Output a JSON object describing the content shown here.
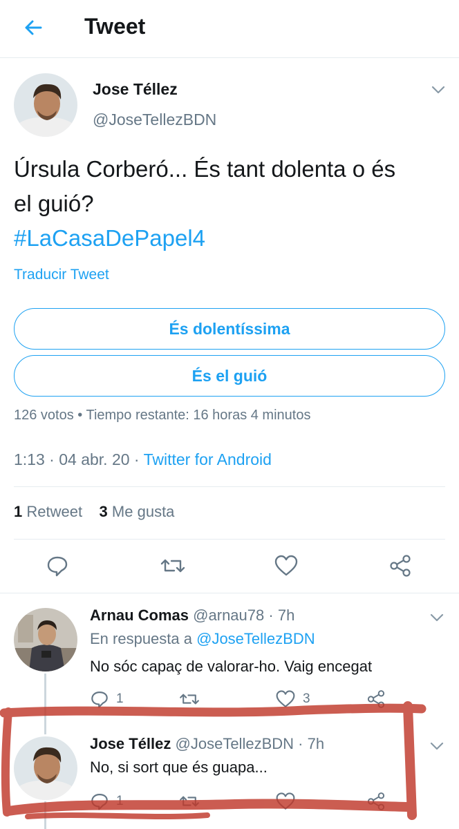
{
  "header": {
    "title": "Tweet"
  },
  "tweet": {
    "author_name": "Jose Téllez",
    "author_handle": "@JoseTellezBDN",
    "text_line1": "Úrsula Corberó... És tant dolenta o és",
    "text_line2": "el guió?",
    "hashtag": "#LaCasaDePapel4",
    "translate_label": "Traducir Tweet",
    "poll": {
      "options": [
        "És dolentíssima",
        "És el guió"
      ],
      "meta": "126 votos • Tiempo restante: 16 horas 4 minutos"
    },
    "time": "1:13",
    "date": "04 abr. 20",
    "source": "Twitter for Android",
    "retweets_count": "1",
    "retweets_label": "Retweet",
    "likes_count": "3",
    "likes_label": "Me gusta"
  },
  "replies": [
    {
      "name": "Arnau Comas",
      "handle": "@arnau78",
      "time": "7h",
      "reply_prefix": "En respuesta a",
      "reply_mention": "@JoseTellezBDN",
      "text": "No sóc capaç de valorar-ho. Vaig encegat",
      "reply_count": "1",
      "like_count": "3"
    },
    {
      "name": "Jose Téllez",
      "handle": "@JoseTellezBDN",
      "time": "7h",
      "text": "No, si sort que és guapa...",
      "reply_count": "1"
    }
  ],
  "colors": {
    "accent": "#1da1f2",
    "secondary_text": "#657786",
    "divider": "#e6ecf0",
    "annotation": "#c0392b"
  },
  "icons": [
    "back-arrow-icon",
    "chevron-down-icon",
    "reply-icon",
    "retweet-icon",
    "like-icon",
    "share-icon"
  ]
}
